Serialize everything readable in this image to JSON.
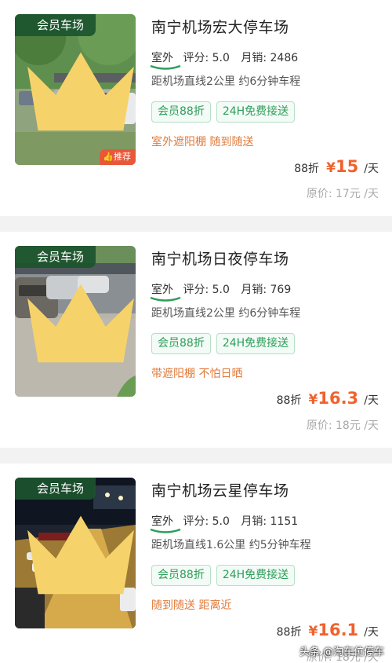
{
  "listings": [
    {
      "badge": "会员车场",
      "title": "南宁机场宏大停车场",
      "env": "室外",
      "rating_label": "评分:",
      "rating": "5.0",
      "sales_label": "月销:",
      "sales": "2486",
      "distance": "距机场直线2公里 约6分钟车程",
      "tags": [
        "会员88折",
        "24H免费接送"
      ],
      "feature": "室外遮阳棚 随到随送",
      "discount": "88折",
      "currency": "¥",
      "price": "15",
      "unit": "/天",
      "original": "原价: 17元 /天",
      "recommend": "推荐"
    },
    {
      "badge": "会员车场",
      "title": "南宁机场日夜停车场",
      "env": "室外",
      "rating_label": "评分:",
      "rating": "5.0",
      "sales_label": "月销:",
      "sales": "769",
      "distance": "距机场直线2公里 约6分钟车程",
      "tags": [
        "会员88折",
        "24H免费接送"
      ],
      "feature": "带遮阳棚 不怕日晒",
      "discount": "88折",
      "currency": "¥",
      "price": "16.3",
      "unit": "/天",
      "original": "原价: 18元 /天"
    },
    {
      "badge": "会员车场",
      "title": "南宁机场云星停车场",
      "env": "室外",
      "rating_label": "评分:",
      "rating": "5.0",
      "sales_label": "月销:",
      "sales": "1151",
      "distance": "距机场直线1.6公里 约5分钟车程",
      "tags": [
        "会员88折",
        "24H免费接送"
      ],
      "feature": "随到随送 距离近",
      "discount": "88折",
      "currency": "¥",
      "price": "16.1",
      "unit": "/天",
      "original": "原价: 18元 /天"
    }
  ],
  "watermark": "头条 @淘车位停车",
  "colors": {
    "price": "#f0622d",
    "feature": "#e07a3a",
    "tag_text": "#2e9e5b",
    "badge_bg": "#1b542e"
  },
  "icons": [
    "crown-icon",
    "thumbs-up-icon"
  ]
}
